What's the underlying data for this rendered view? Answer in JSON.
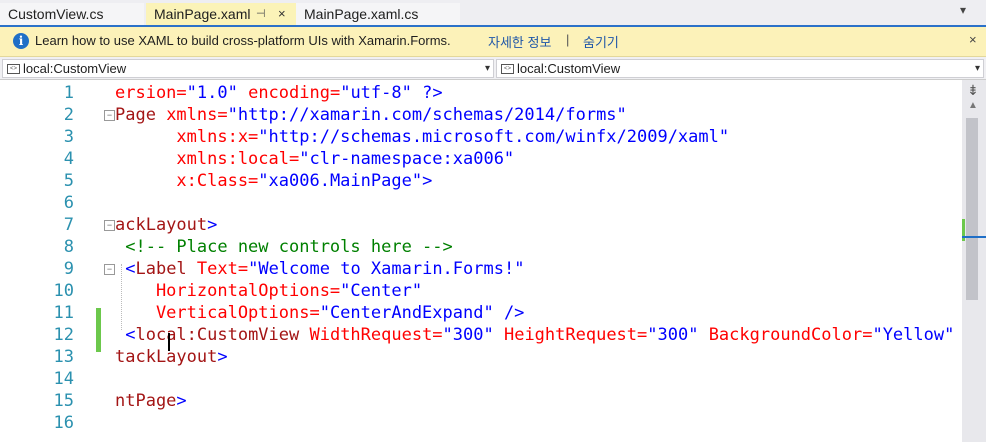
{
  "tabs": [
    {
      "label": "CustomView.cs",
      "active": false
    },
    {
      "label": "MainPage.xaml",
      "active": true,
      "pin": "⊣",
      "close": "×"
    },
    {
      "label": "MainPage.xaml.cs",
      "active": false
    }
  ],
  "tab_overflow_icon": "chevron-down-icon",
  "infobar": {
    "icon": "info-icon",
    "message": "Learn how to use XAML to build cross-platform UIs with Xamarin.Forms.",
    "more_info_link": "자세한 정보",
    "separator": "|",
    "hide_link": "숨기기",
    "close": "×"
  },
  "navbar": {
    "left_combo": "local:CustomView",
    "right_combo": "local:CustomView"
  },
  "editor": {
    "lines": [
      {
        "n": "1"
      },
      {
        "n": "2"
      },
      {
        "n": "3"
      },
      {
        "n": "4"
      },
      {
        "n": "5"
      },
      {
        "n": "6"
      },
      {
        "n": "7"
      },
      {
        "n": "8"
      },
      {
        "n": "9"
      },
      {
        "n": "10"
      },
      {
        "n": "11"
      },
      {
        "n": "12"
      },
      {
        "n": "13"
      },
      {
        "n": "14"
      },
      {
        "n": "15"
      },
      {
        "n": "16"
      }
    ],
    "code": {
      "l1": [
        "ersion=",
        "\"1.0\"",
        " encoding=",
        "\"utf-8\"",
        " ?>"
      ],
      "l2": [
        "Page",
        " xmlns=",
        "\"http://xamarin.com/schemas/2014/forms\""
      ],
      "l3": [
        "      xmlns:x=",
        "\"http://schemas.microsoft.com/winfx/2009/xaml\""
      ],
      "l4": [
        "      xmlns:local=",
        "\"clr-namespace:xa006\""
      ],
      "l5": [
        "      x:Class=",
        "\"xa006.MainPage\"",
        ">"
      ],
      "l7": [
        "ackLayout",
        ">"
      ],
      "l8": [
        " <!-- Place new controls here -->"
      ],
      "l9": [
        " <",
        "Label",
        " Text=",
        "\"Welcome to Xamarin.Forms!\""
      ],
      "l10": [
        "    HorizontalOptions=",
        "\"Center\""
      ],
      "l11": [
        "    VerticalOptions=",
        "\"CenterAndExpand\"",
        " />"
      ],
      "l12": [
        " <",
        "local:CustomView",
        " WidthRequest=",
        "\"300\"",
        " HeightRequest=",
        "\"300\"",
        " BackgroundColor=",
        "\"Yellow\"",
        " /"
      ],
      "l13": [
        "tackLayout",
        ">"
      ],
      "l15": [
        "ntPage",
        ">"
      ]
    }
  },
  "colors": {
    "keyword": "#0000ff",
    "attribute": "#ff0000",
    "element": "#a31515",
    "comment": "#008000",
    "line_number": "#2b91af",
    "accent": "#2b71c9"
  },
  "scrollbar": {
    "split_icon": "split-icon",
    "up_icon": "scroll-up-icon"
  }
}
